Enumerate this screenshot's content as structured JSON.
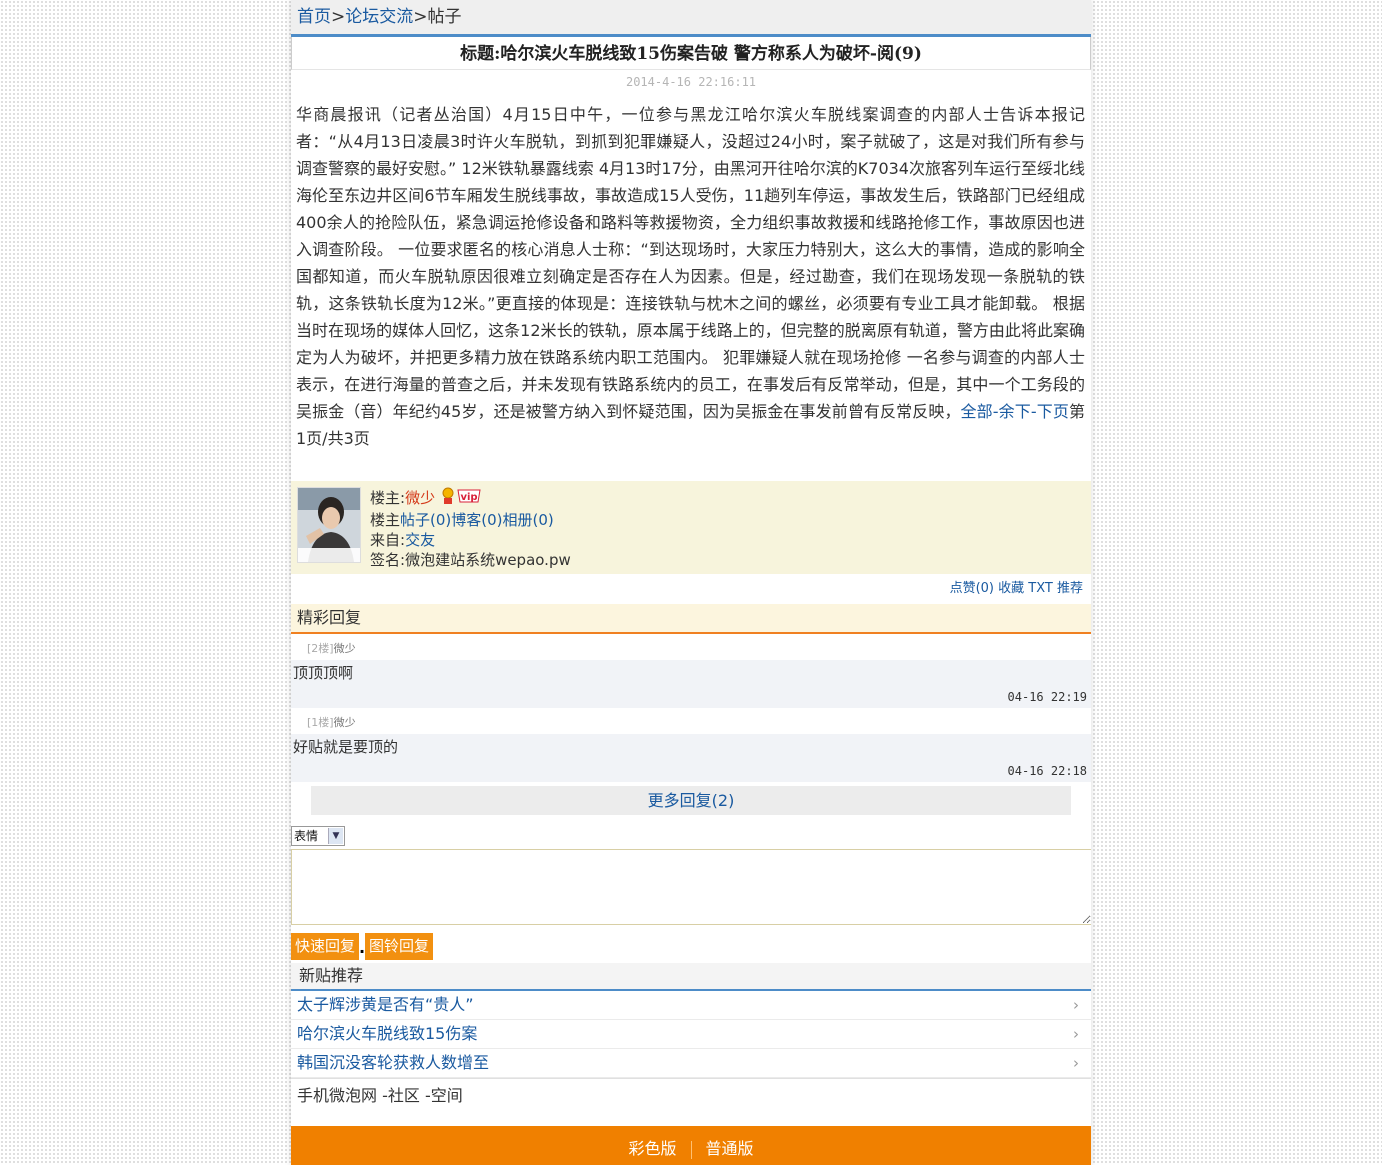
{
  "breadcrumb": {
    "home": "首页",
    "sep": ">",
    "forum": "论坛交流",
    "current": "帖子"
  },
  "post": {
    "title": "标题:哈尔滨火车脱线致15伤案告破 警方称系人为破坏-阅(9)",
    "datetime": "2014-4-16 22:16:11",
    "body": "华商晨报讯（记者丛治国）4月15日中午，一位参与黑龙江哈尔滨火车脱线案调查的内部人士告诉本报记者：“从4月13日凌晨3时许火车脱轨，到抓到犯罪嫌疑人，没超过24小时，案子就破了，这是对我们所有参与调查警察的最好安慰。”  12米铁轨暴露线索 4月13时17分，由黑河开往哈尔滨的K7034次旅客列车运行至绥北线海伦至东边井区间6节车厢发生脱线事故，事故造成15人受伤，11趟列车停运，事故发生后，铁路部门已经组成400余人的抢险队伍，紧急调运抢修设备和路料等救援物资，全力组织事故救援和线路抢修工作，事故原因也进入调查阶段。 一位要求匿名的核心消息人士称：“到达现场时，大家压力特别大，这么大的事情，造成的影响全国都知道，而火车脱轨原因很难立刻确定是否存在人为因素。但是，经过勘查，我们在现场发现一条脱轨的铁轨，这条铁轨长度为12米。”更直接的体现是：连接铁轨与枕木之间的螺丝，必须要有专业工具才能卸载。 根据当时在现场的媒体人回忆，这条12米长的铁轨，原本属于线路上的，但完整的脱离原有轨道，警方由此将此案确定为人为破坏，并把更多精力放在铁路系统内职工范围内。 犯罪嫌疑人就在现场抢修 一名参与调查的内部人士表示，在进行海量的普查之后，并未发现有铁路系统内的员工，在事发后有反常举动，但是，其中一个工务段的吴振金（音）年纪约45岁，还是被警方纳入到怀疑范围，因为吴振金在事发前曾有反常反映，",
    "pager": {
      "all": "全部",
      "dash1": "-",
      "rest": "余下",
      "dash2": "-",
      "next": "下页",
      "info": "第1页/共3页"
    }
  },
  "author": {
    "owner_label": "楼主:",
    "owner_name": "微少",
    "badge_text": "vip",
    "links_label": "楼主",
    "posts": "帖子(0)",
    "blog": "博客(0)",
    "album": "相册(0)",
    "from_label": "来自:",
    "from_value": "交友",
    "sign_label": "签名:",
    "sign_value": "微泡建站系统wepao.pw"
  },
  "actions": {
    "like": "点赞(0)",
    "fav": "收藏",
    "txt": "TXT",
    "recommend": "推荐"
  },
  "replies_section": {
    "title": "精彩回复",
    "items": [
      {
        "floor": "[2楼]",
        "user": "微少",
        "text": "顶顶顶啊",
        "time": "04-16 22:19"
      },
      {
        "floor": "[1楼]",
        "user": "微少",
        "text": "好贴就是要顶的",
        "time": "04-16 22:18"
      }
    ],
    "more": "更多回复(2)"
  },
  "reply_form": {
    "emoji_select": "表情",
    "textarea_placeholder": "",
    "quick_reply": "快速回复",
    "separator": ".",
    "image_reply": "图铃回复"
  },
  "recommend": {
    "title": "新贴推荐",
    "items": [
      {
        "title": "太子辉涉黄是否有“贵人”"
      },
      {
        "title": "哈尔滨火车脱线致15伤案"
      },
      {
        "title": "韩国沉没客轮获救人数增至"
      }
    ]
  },
  "footer_links": {
    "site": "手机微泡网",
    "sep1": " -",
    "community": "社区",
    "sep2": " -",
    "space": "空间"
  },
  "bottom_bar": {
    "color": "彩色版",
    "plain": "普通版"
  },
  "colors": {
    "accent_orange": "#f08000",
    "link_blue": "#1a5aa0",
    "rule_blue": "#4d8cc8"
  }
}
